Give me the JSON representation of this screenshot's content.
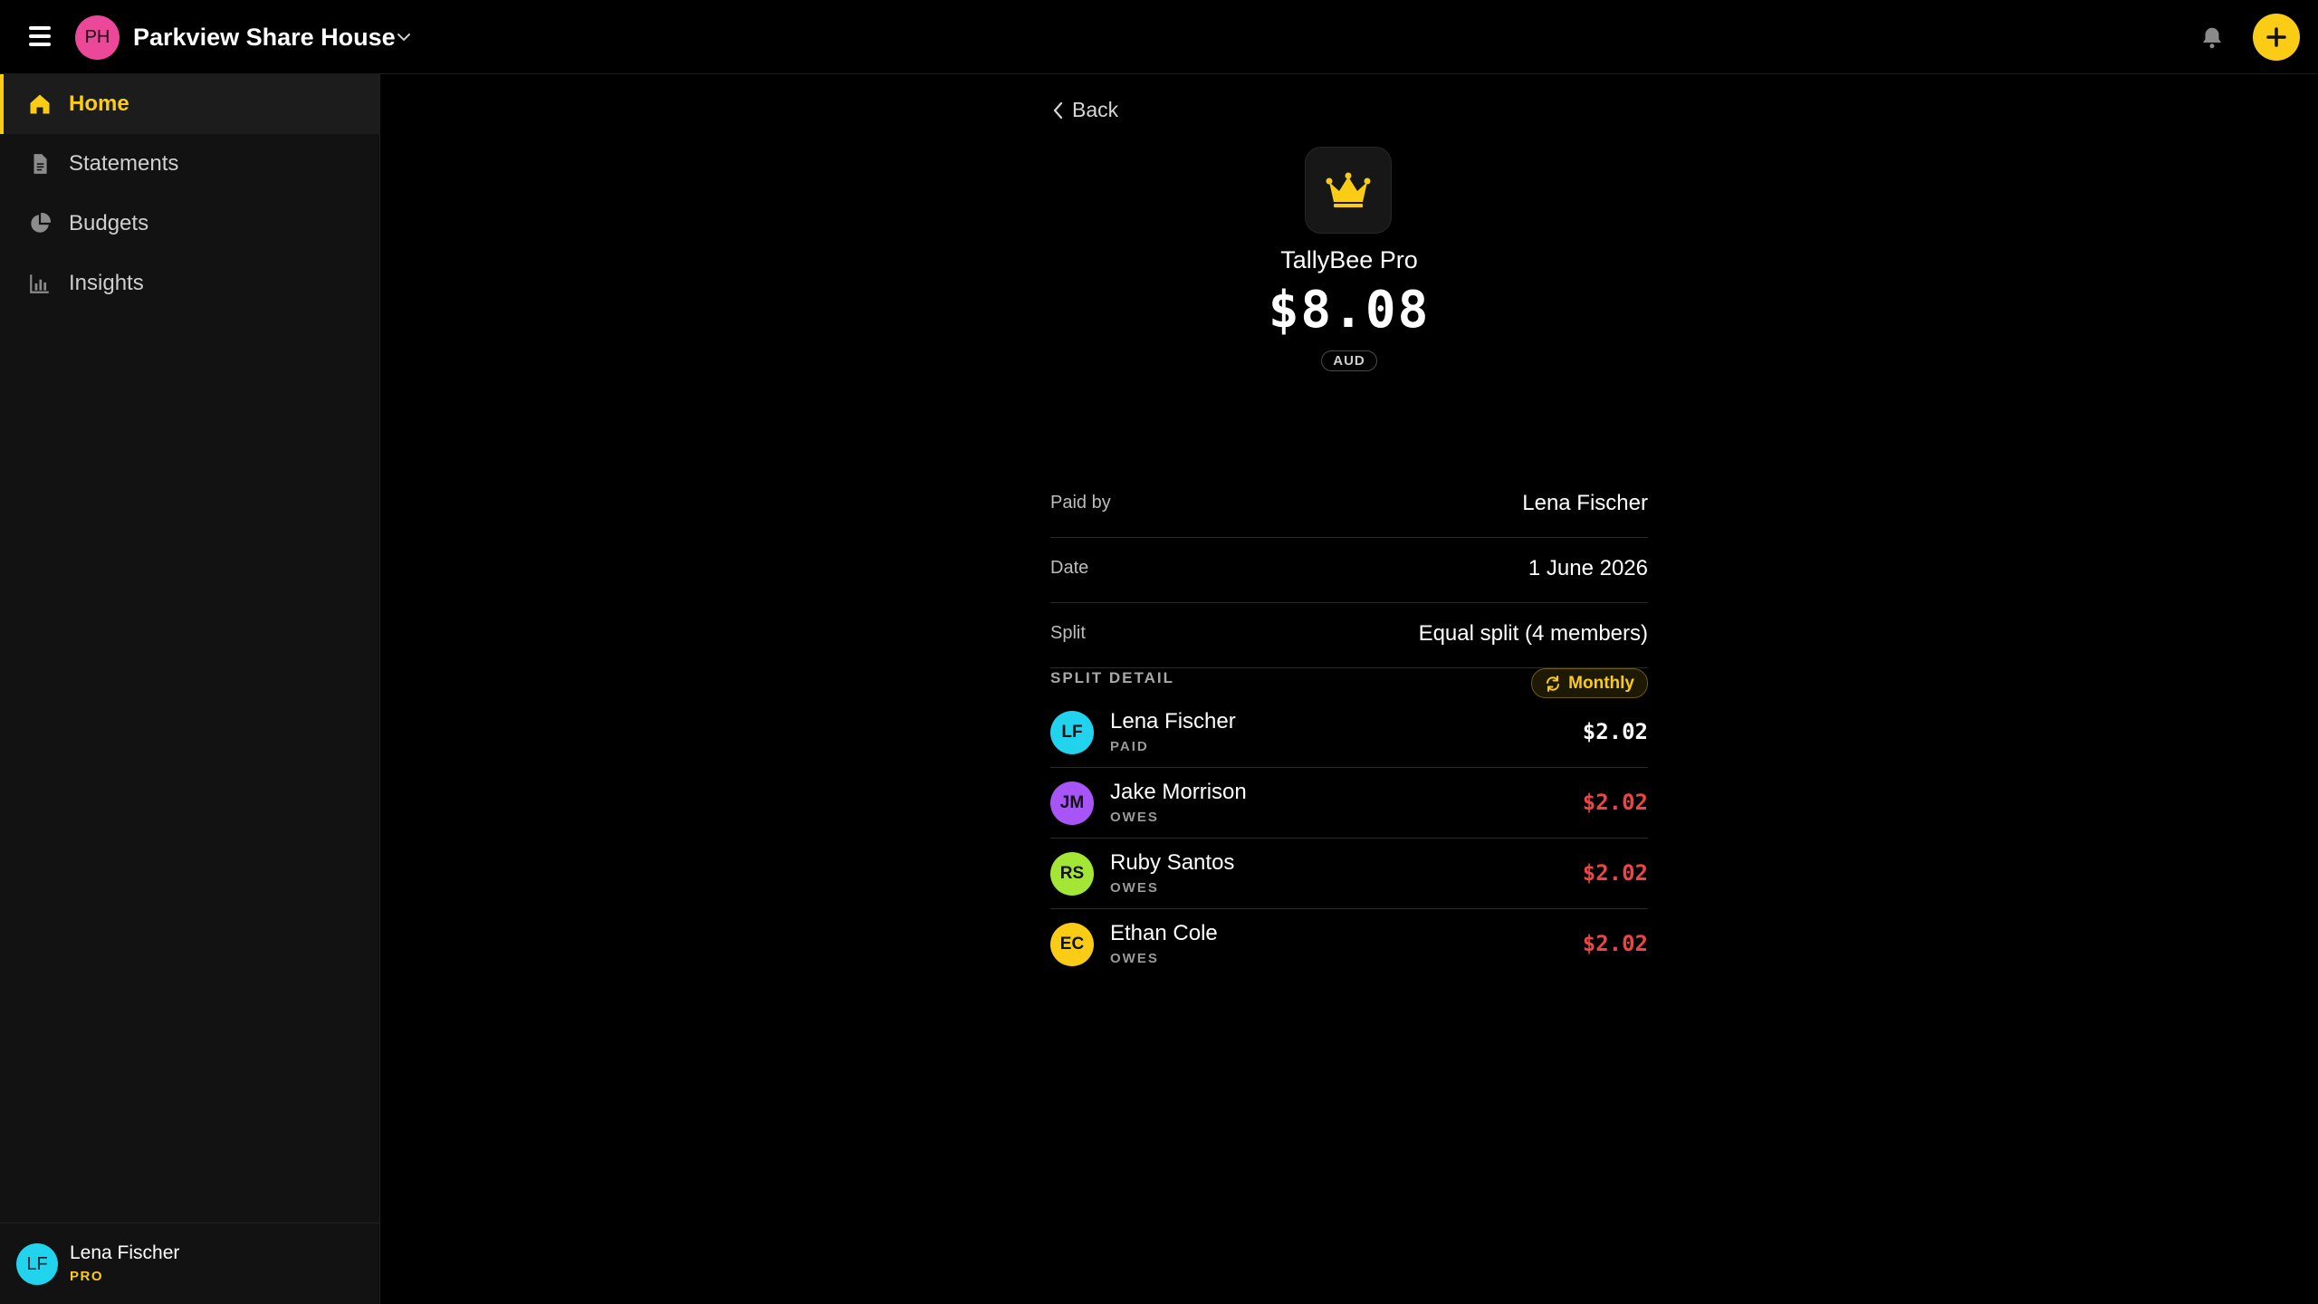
{
  "header": {
    "group_initials": "PH",
    "group_name": "Parkview Share House",
    "group_color": "#ec4899",
    "menu_icon": "hamburger-icon",
    "bell_icon": "bell-icon",
    "add_icon": "plus-icon",
    "accent_color": "#facc15"
  },
  "sidebar": {
    "items": [
      {
        "label": "Home",
        "icon": "home-icon",
        "active": true
      },
      {
        "label": "Statements",
        "icon": "document-icon",
        "active": false
      },
      {
        "label": "Budgets",
        "icon": "pie-chart-icon",
        "active": false
      },
      {
        "label": "Insights",
        "icon": "bar-chart-icon",
        "active": false
      }
    ],
    "user": {
      "initials": "LF",
      "name": "Lena Fischer",
      "plan": "PRO",
      "color": "#22d3ee"
    }
  },
  "expense": {
    "back_label": "Back",
    "icon": "crown-icon",
    "title": "TallyBee Pro",
    "amount": "$8.08",
    "currency": "AUD",
    "details": [
      {
        "label": "Paid by",
        "value": "Lena Fischer"
      },
      {
        "label": "Date",
        "value": "1 June 2026"
      },
      {
        "label": "Split",
        "value": "Equal split (4 members)"
      }
    ],
    "recurring_label": "Monthly",
    "recurring_icon": "repeat-icon",
    "split_header": "SPLIT DETAIL",
    "split": [
      {
        "initials": "LF",
        "name": "Lena Fischer",
        "status": "PAID",
        "amount": "$2.02",
        "avatar_color": "#22d3ee",
        "amount_color": "#ffffff"
      },
      {
        "initials": "JM",
        "name": "Jake Morrison",
        "status": "OWES",
        "amount": "$2.02",
        "avatar_color": "#a855f7",
        "amount_color": "#ef4444"
      },
      {
        "initials": "RS",
        "name": "Ruby Santos",
        "status": "OWES",
        "amount": "$2.02",
        "avatar_color": "#a3e635",
        "amount_color": "#ef4444"
      },
      {
        "initials": "EC",
        "name": "Ethan Cole",
        "status": "OWES",
        "amount": "$2.02",
        "avatar_color": "#facc15",
        "amount_color": "#ef4444"
      }
    ]
  }
}
